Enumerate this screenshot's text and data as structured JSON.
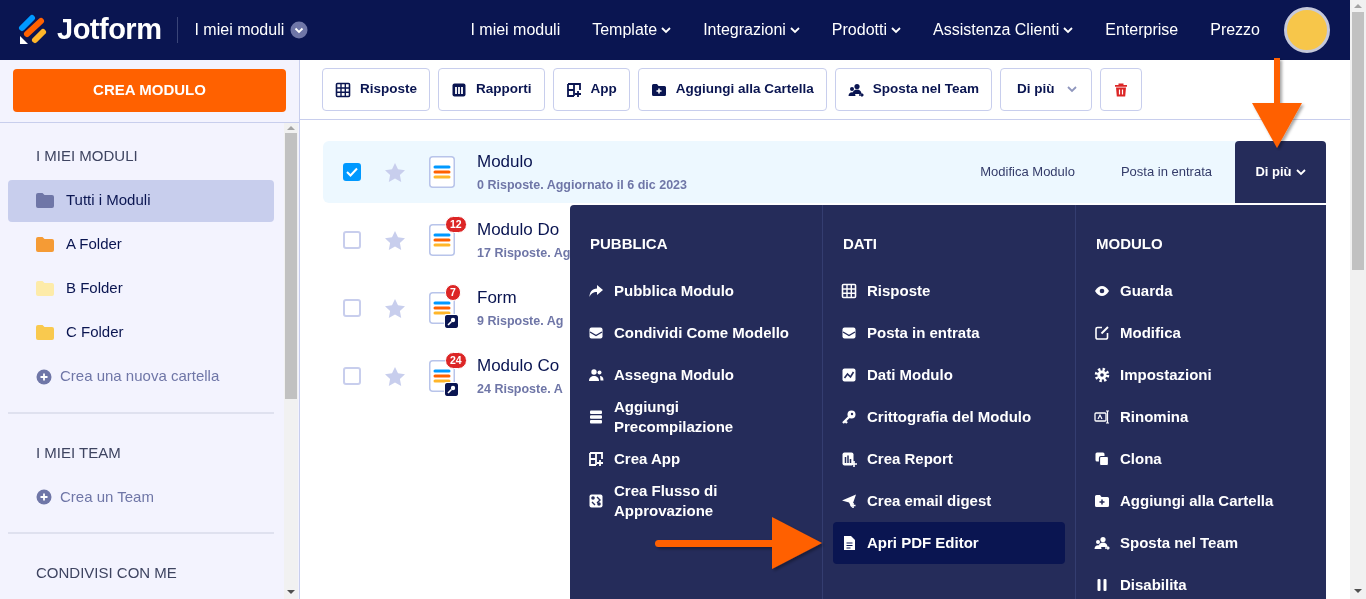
{
  "navbar": {
    "logo": "Jotform",
    "workspace": "I miei moduli",
    "links": [
      {
        "label": "I miei moduli",
        "dropdown": false
      },
      {
        "label": "Template",
        "dropdown": true
      },
      {
        "label": "Integrazioni",
        "dropdown": true
      },
      {
        "label": "Prodotti",
        "dropdown": true
      },
      {
        "label": "Assistenza Clienti",
        "dropdown": true
      },
      {
        "label": "Enterprise",
        "dropdown": false
      },
      {
        "label": "Prezzo",
        "dropdown": false
      }
    ]
  },
  "sidebar": {
    "create_button": "CREA MODULO",
    "sections": [
      {
        "heading": "I MIEI MODULI",
        "items": [
          {
            "kind": "folder",
            "label": "Tutti i Moduli",
            "color": "#6f76a7",
            "selected": true
          },
          {
            "kind": "folder",
            "label": "A Folder",
            "color": "#f59b35",
            "selected": false
          },
          {
            "kind": "folder",
            "label": "B Folder",
            "color": "#fdeba9",
            "selected": false
          },
          {
            "kind": "folder",
            "label": "C Folder",
            "color": "#f9c94e",
            "selected": false
          },
          {
            "kind": "add",
            "label": "Crea una nuova cartella",
            "selected": false
          }
        ]
      },
      {
        "heading": "I MIEI TEAM",
        "items": [
          {
            "kind": "add",
            "label": "Crea un Team",
            "selected": false
          }
        ]
      },
      {
        "heading": "CONDIVISI CON ME"
      }
    ]
  },
  "toolbar": {
    "buttons": [
      {
        "kind": "text",
        "label": "Risposte"
      },
      {
        "kind": "text",
        "label": "Rapporti"
      },
      {
        "kind": "text",
        "label": "App"
      },
      {
        "kind": "text",
        "label": "Aggiungi alla Cartella"
      },
      {
        "kind": "text",
        "label": "Sposta nel Team"
      },
      {
        "kind": "dropdown",
        "label": "Di più"
      },
      {
        "kind": "delete"
      }
    ]
  },
  "forms": [
    {
      "title": "Modulo",
      "subtitle": "0 Risposte. Aggiornato il 6 dic 2023",
      "checked": true,
      "selected": true,
      "starred": false,
      "encrypted": false,
      "actions": [
        "Modifica Modulo",
        "Posta in entrata"
      ],
      "more_button": {
        "label": "Di più",
        "expanded": true
      }
    },
    {
      "title": "Modulo Do",
      "subtitle": "17 Risposte. Ag",
      "checked": false,
      "selected": false,
      "starred": false,
      "encrypted": false,
      "badge": "12"
    },
    {
      "title": "Form",
      "subtitle": "9 Risposte. Ag",
      "checked": false,
      "selected": false,
      "starred": false,
      "encrypted": true,
      "badge": "7"
    },
    {
      "title": "Modulo Co",
      "subtitle": "24 Risposte. A",
      "checked": false,
      "selected": false,
      "starred": false,
      "encrypted": true,
      "badge": "24"
    }
  ],
  "more_menu": {
    "columns": [
      {
        "heading": "PUBBLICA",
        "items": [
          {
            "label": "Pubblica Modulo",
            "selected": false
          },
          {
            "label": "Condividi Come Modello",
            "selected": false
          },
          {
            "label": "Assegna Modulo",
            "selected": false
          },
          {
            "label": "Aggiungi Precompilazione",
            "selected": false
          },
          {
            "label": "Crea App",
            "selected": false
          },
          {
            "label": "Crea Flusso di Approvazione",
            "selected": false
          }
        ]
      },
      {
        "heading": "DATI",
        "items": [
          {
            "label": "Risposte",
            "selected": false
          },
          {
            "label": "Posta in entrata",
            "selected": false
          },
          {
            "label": "Dati Modulo",
            "selected": false
          },
          {
            "label": "Crittografia del Modulo",
            "selected": false
          },
          {
            "label": "Crea Report",
            "selected": false
          },
          {
            "label": "Crea email digest",
            "selected": false
          },
          {
            "label": "Apri PDF Editor",
            "selected": true
          }
        ]
      },
      {
        "heading": "MODULO",
        "items": [
          {
            "label": "Guarda",
            "selected": false
          },
          {
            "label": "Modifica",
            "selected": false
          },
          {
            "label": "Impostazioni",
            "selected": false
          },
          {
            "label": "Rinomina",
            "selected": false
          },
          {
            "label": "Clona",
            "selected": false
          },
          {
            "label": "Aggiungi alla Cartella",
            "selected": false
          },
          {
            "label": "Sposta nel Team",
            "selected": false
          },
          {
            "label": "Disabilita",
            "selected": false
          }
        ]
      }
    ]
  }
}
